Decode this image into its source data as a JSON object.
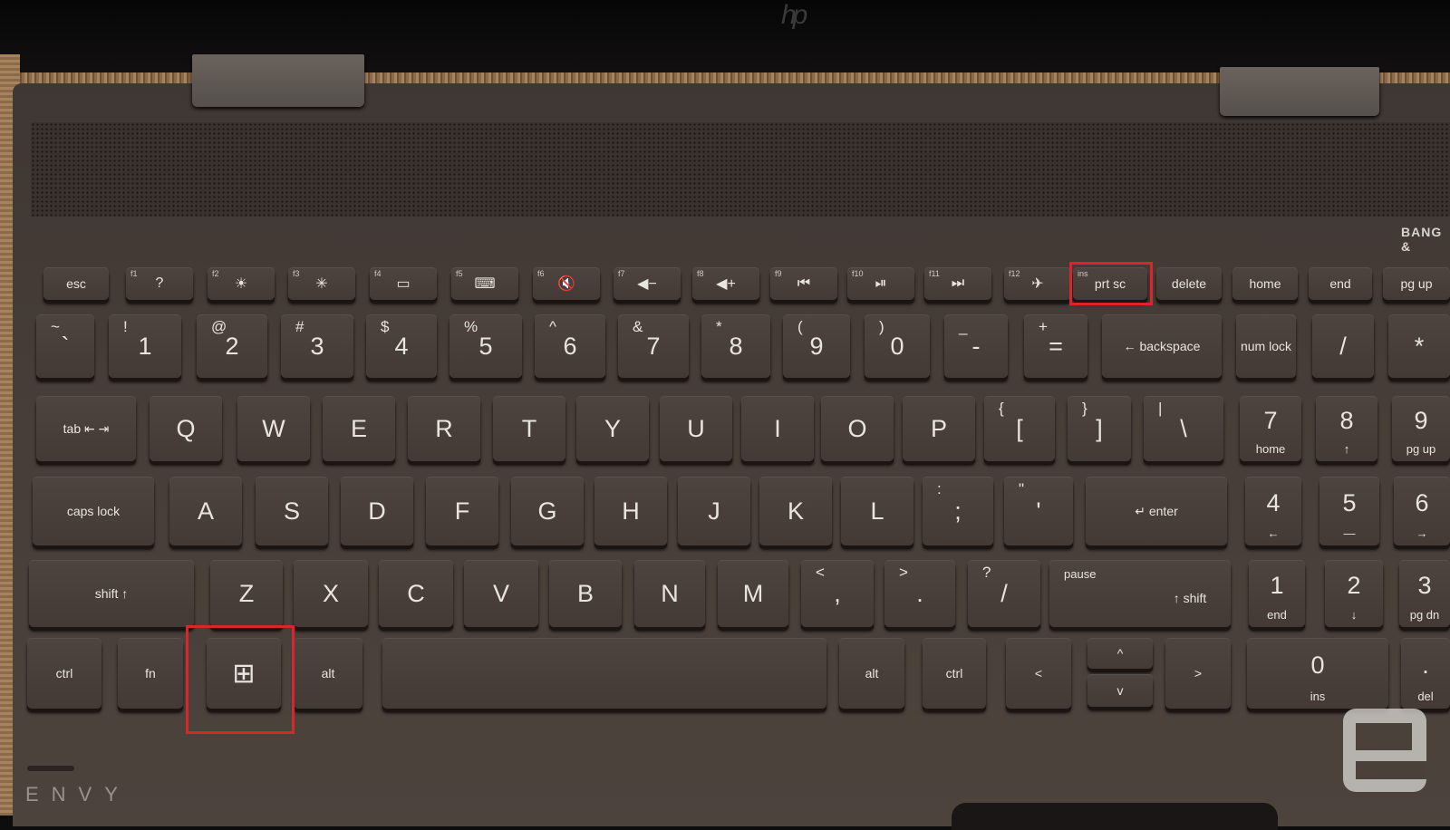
{
  "branding": {
    "logo": "hp",
    "model": "ENVY",
    "audio": "BANG &"
  },
  "watermark": {
    "name": "engadget-logo"
  },
  "highlight_color": "#d8262c",
  "highlighted_keys": [
    "prt sc",
    "windows"
  ],
  "rows": {
    "function": [
      {
        "label": "esc"
      },
      {
        "fn": "f1",
        "label": "?"
      },
      {
        "fn": "f2",
        "label": "☀"
      },
      {
        "fn": "f3",
        "label": "✳"
      },
      {
        "fn": "f4",
        "label": "▭"
      },
      {
        "fn": "f5",
        "label": "⌨"
      },
      {
        "fn": "f6",
        "label": "🔇"
      },
      {
        "fn": "f7",
        "label": "◀−"
      },
      {
        "fn": "f8",
        "label": "◀+"
      },
      {
        "fn": "f9",
        "label": "⏮"
      },
      {
        "fn": "f10",
        "label": "⏯"
      },
      {
        "fn": "f11",
        "label": "⏭"
      },
      {
        "fn": "f12",
        "label": "✈"
      },
      {
        "fn": "ins",
        "label": "prt sc"
      },
      {
        "label": "delete"
      },
      {
        "label": "home"
      },
      {
        "label": "end"
      },
      {
        "label": "pg up"
      }
    ],
    "number": [
      {
        "top": "~",
        "main": "`"
      },
      {
        "top": "!",
        "main": "1"
      },
      {
        "top": "@",
        "main": "2"
      },
      {
        "top": "#",
        "main": "3"
      },
      {
        "top": "$",
        "main": "4"
      },
      {
        "top": "%",
        "main": "5"
      },
      {
        "top": "^",
        "main": "6"
      },
      {
        "top": "&",
        "main": "7"
      },
      {
        "top": "*",
        "main": "8"
      },
      {
        "top": "(",
        "main": "9"
      },
      {
        "top": ")",
        "main": "0"
      },
      {
        "top": "_",
        "main": "-"
      },
      {
        "top": "+",
        "main": "="
      },
      {
        "label": "← backspace"
      },
      {
        "label": "num lock"
      },
      {
        "main": "/"
      },
      {
        "main": "*"
      }
    ],
    "qwerty": [
      {
        "label": "tab ⇤ ⇥"
      },
      {
        "main": "Q"
      },
      {
        "main": "W"
      },
      {
        "main": "E"
      },
      {
        "main": "R"
      },
      {
        "main": "T"
      },
      {
        "main": "Y"
      },
      {
        "main": "U"
      },
      {
        "main": "I"
      },
      {
        "main": "O"
      },
      {
        "main": "P"
      },
      {
        "top": "{",
        "main": "["
      },
      {
        "top": "}",
        "main": "]"
      },
      {
        "top": "|",
        "main": "\\"
      },
      {
        "main": "7",
        "sub": "home"
      },
      {
        "main": "8",
        "sub": "↑"
      },
      {
        "main": "9",
        "sub": "pg up"
      }
    ],
    "home": [
      {
        "label": "caps lock"
      },
      {
        "main": "A"
      },
      {
        "main": "S"
      },
      {
        "main": "D"
      },
      {
        "main": "F"
      },
      {
        "main": "G"
      },
      {
        "main": "H"
      },
      {
        "main": "J"
      },
      {
        "main": "K"
      },
      {
        "main": "L"
      },
      {
        "top": ":",
        "main": ";"
      },
      {
        "top": "\"",
        "main": "'"
      },
      {
        "label": "↵          enter"
      },
      {
        "main": "4",
        "sub": "←"
      },
      {
        "main": "5",
        "sub": "—"
      },
      {
        "main": "6",
        "sub": "→"
      }
    ],
    "shift": [
      {
        "label": "shift ↑"
      },
      {
        "main": "Z"
      },
      {
        "main": "X"
      },
      {
        "main": "C"
      },
      {
        "main": "V"
      },
      {
        "main": "B"
      },
      {
        "main": "N"
      },
      {
        "main": "M"
      },
      {
        "top": "<",
        "main": ","
      },
      {
        "top": ">",
        "main": "."
      },
      {
        "top": "?",
        "main": "/"
      },
      {
        "top": "pause",
        "label": "↑ shift"
      },
      {
        "main": "1",
        "sub": "end"
      },
      {
        "main": "2",
        "sub": "↓"
      },
      {
        "main": "3",
        "sub": "pg dn"
      }
    ],
    "bottom": [
      {
        "label": "ctrl"
      },
      {
        "label": "fn"
      },
      {
        "label": "⊞"
      },
      {
        "label": "alt"
      },
      {
        "label": ""
      },
      {
        "label": "alt"
      },
      {
        "label": "ctrl"
      },
      {
        "label": "<"
      },
      {
        "label": "^"
      },
      {
        "label": "v"
      },
      {
        "label": ">"
      },
      {
        "main": "0",
        "sub": "ins"
      },
      {
        "main": ".",
        "sub": "del"
      }
    ]
  }
}
